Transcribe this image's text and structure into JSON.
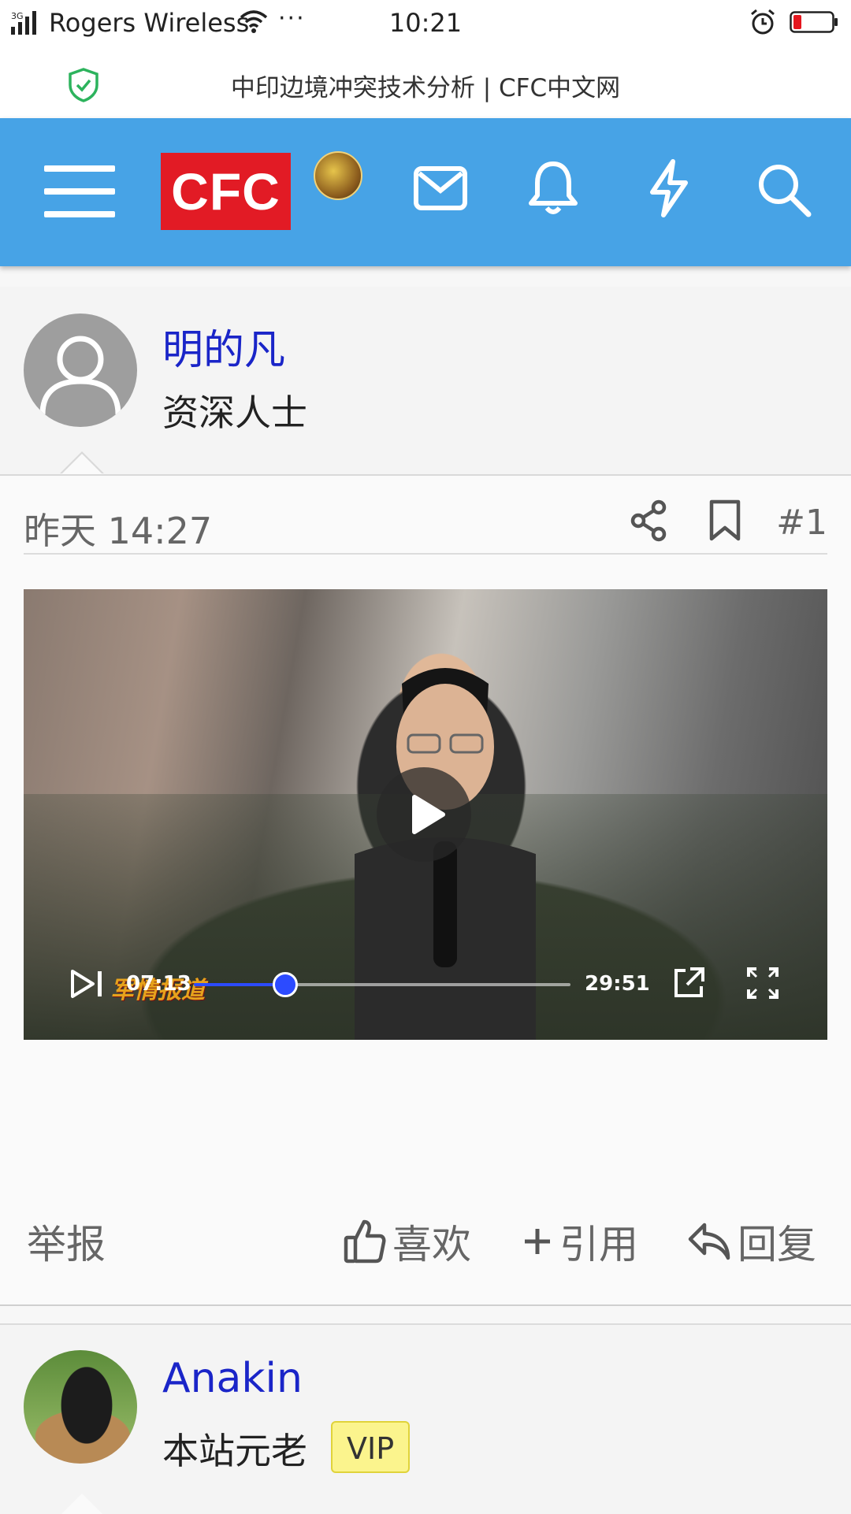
{
  "status_bar": {
    "network": "3G",
    "carrier": "Rogers Wireless",
    "more": "···",
    "time": "10:21"
  },
  "browser": {
    "page_title": "中印边境冲突技术分析 | CFC中文网"
  },
  "nav": {
    "logo_text": "CFC",
    "icons": [
      "menu-icon",
      "user-avatar",
      "mail-icon",
      "bell-icon",
      "bolt-icon",
      "search-icon"
    ],
    "bar_color": "#47a3e6",
    "logo_color": "#e21b25"
  },
  "posts": [
    {
      "username": "明的凡",
      "user_title": "资深人士",
      "date": "昨天 14:27",
      "post_number": "#1",
      "video": {
        "current_time": "07:13",
        "duration": "29:51",
        "progress_fraction": 0.242
      },
      "actions": {
        "report": "举报",
        "like": "喜欢",
        "quote": "引用",
        "reply": "回复"
      }
    },
    {
      "username": "Anakin",
      "user_title": "本站元老",
      "badge": "VIP"
    }
  ],
  "accent_colors": {
    "username": "#1a25c8",
    "progress": "#2c4bff",
    "vip_badge": "#fbf48d"
  }
}
